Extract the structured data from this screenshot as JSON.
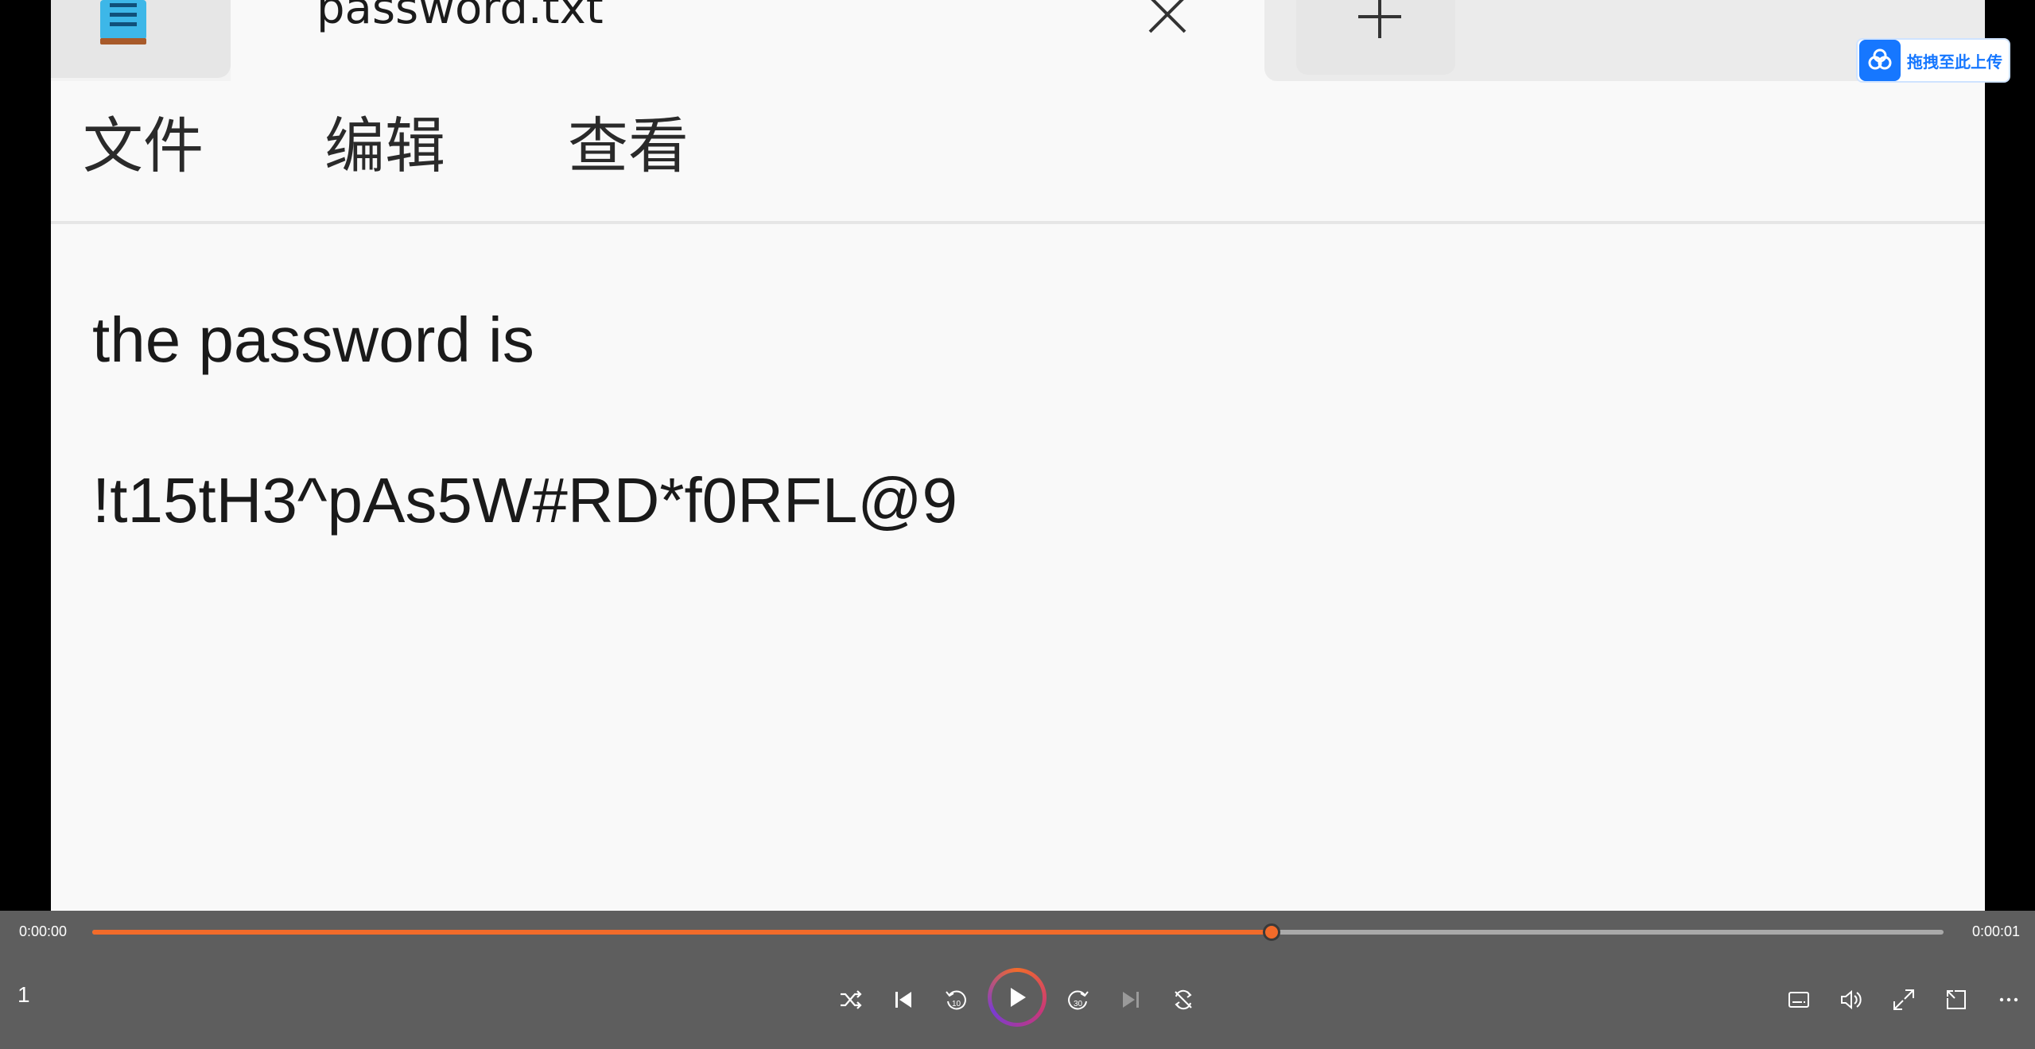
{
  "tab": {
    "title": "password.txt",
    "file_icon": "notepad-icon",
    "close_icon": "close-icon",
    "new_tab_icon": "plus-icon"
  },
  "menu": {
    "items": [
      {
        "label": "文件"
      },
      {
        "label": "编辑"
      },
      {
        "label": "查看"
      }
    ]
  },
  "editor": {
    "lines": [
      "the password is",
      "!t15tH3^pAs5W#RD*f0RFL@9"
    ]
  },
  "upload_badge": {
    "label": "拖拽至此上传",
    "icon": "cloud-upload-icon"
  },
  "player": {
    "time_current": "0:00:00",
    "time_total": "0:00:01",
    "progress": 0.637,
    "playlist_index": "1",
    "accent_color": "#f26b2a",
    "buttons": [
      "shuffle-icon",
      "previous-icon",
      "rewind-10-icon",
      "play-icon",
      "forward-30-icon",
      "next-icon",
      "repeat-off-icon",
      "subtitles-icon",
      "volume-icon",
      "fullscreen-icon",
      "mini-player-icon",
      "more-icon"
    ]
  }
}
